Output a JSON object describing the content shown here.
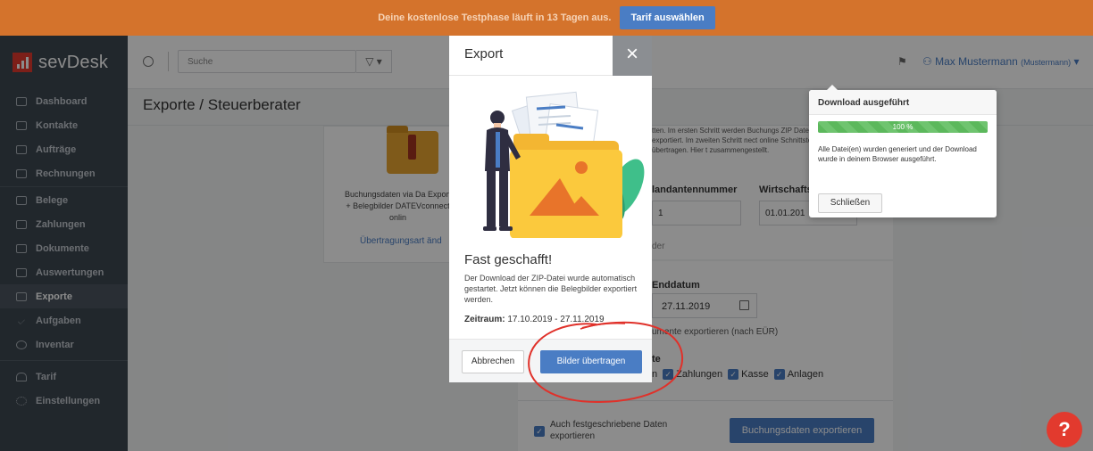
{
  "banner": {
    "text": "Deine kostenlose Testphase läuft in 13 Tagen aus.",
    "cta": "Tarif auswählen"
  },
  "brand": {
    "name": "sevDesk"
  },
  "nav": [
    {
      "label": "Dashboard",
      "icon": "dashboard-icon"
    },
    {
      "label": "Kontakte",
      "icon": "contacts-icon"
    },
    {
      "label": "Aufträge",
      "icon": "folder-icon"
    },
    {
      "label": "Rechnungen",
      "icon": "invoice-icon"
    },
    {
      "label": "Belege",
      "icon": "receipt-icon"
    },
    {
      "label": "Zahlungen",
      "icon": "payment-icon"
    },
    {
      "label": "Dokumente",
      "icon": "document-icon"
    },
    {
      "label": "Auswertungen",
      "icon": "report-icon"
    },
    {
      "label": "Exporte",
      "icon": "export-icon"
    },
    {
      "label": "Aufgaben",
      "icon": "check-icon"
    },
    {
      "label": "Inventar",
      "icon": "inventory-icon"
    },
    {
      "label": "Tarif",
      "icon": "bell-icon"
    },
    {
      "label": "Einstellungen",
      "icon": "gear-icon"
    }
  ],
  "topbar": {
    "search_placeholder": "Suche",
    "filter": "▽ ▾",
    "user_name": "Max Mustermann",
    "user_company": "(Mustermann)"
  },
  "page": {
    "title": "Exporte / Steuerberater"
  },
  "card_left": {
    "text": "Buchungsdaten via Da Export + Belegbilder DATEVconnect onlin",
    "link": "Übertragungsart änd"
  },
  "panel_a": {
    "text": "tten. Im ersten Schritt werden Buchungs ZIP Datei exportiert. Im zweiten Schritt nect online Schnittstelle übertragen. Hier t zusammengestellt.",
    "label_mandant": "landantennummer",
    "label_wirtschaft": "Wirtschafts",
    "value_mandant": "1",
    "value_wirtschaft": "01.01.201",
    "extra": "der"
  },
  "panel_b": {
    "label_enddatum": "Enddatum",
    "enddatum": "27.11.2019",
    "sub": "umente exportieren (nach EÜR)",
    "heading": "te",
    "checks": [
      "n",
      "Zahlungen",
      "Kasse",
      "Anlagen"
    ],
    "fixed_label": "Auch festgeschriebene Daten exportieren",
    "export_button": "Buchungsdaten exportieren"
  },
  "popover": {
    "title": "Download ausgeführt",
    "progress": "100 %",
    "progress_value": 1.0,
    "text": "Alle Datei(en) wurden generiert und der Download wurde in deinem Browser ausgeführt.",
    "close": "Schließen"
  },
  "modal": {
    "title": "Export",
    "close": "×",
    "heading": "Fast geschafft!",
    "text": "Der Download der ZIP-Datei wurde automatisch gestartet. Jetzt können die Belegbilder exportiert werden.",
    "range_label": "Zeitraum:",
    "range_value": "17.10.2019 - 27.11.2019",
    "cancel": "Abbrechen",
    "primary": "Bilder übertragen"
  },
  "help": {
    "label": "?"
  },
  "colors": {
    "brand_red": "#e23a2e",
    "banner_orange": "#d4732c",
    "accent_blue": "#4a7dc4",
    "sidebar": "#3d4751",
    "progress_green": "#5cb85c"
  }
}
